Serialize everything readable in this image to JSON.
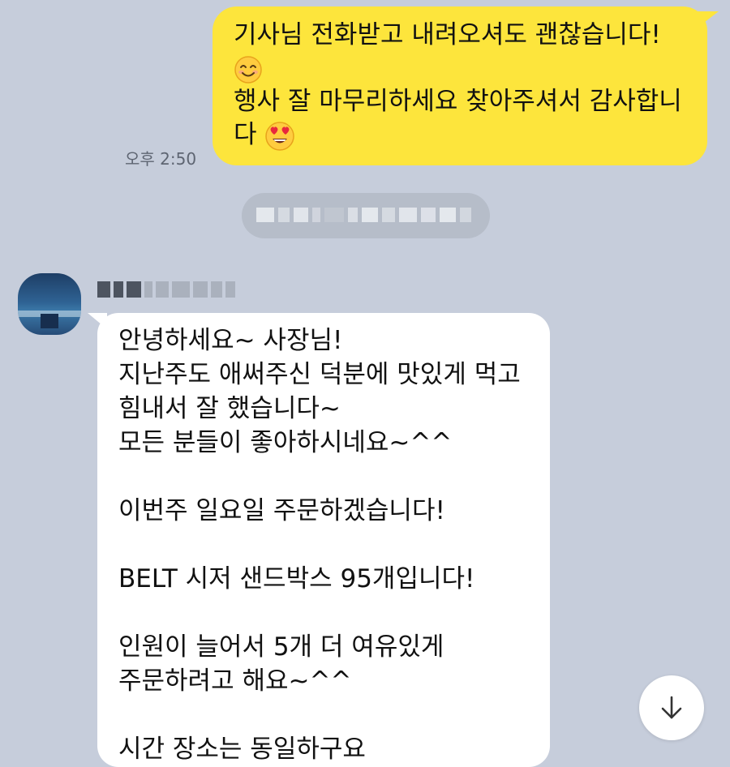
{
  "outgoing": {
    "lines": [
      "기사님 전화받고 내려오셔도 괜찮습니다!",
      "",
      "행사 잘 마무리하세요 찾아주셔서 감사합니",
      "다"
    ],
    "time": "오후 2:50",
    "emojis": [
      "smiling-face-emoji",
      "heart-eyes-emoji"
    ],
    "bubble_color": "#fde53c"
  },
  "incoming": {
    "lines": [
      "안녕하세요~ 사장님!",
      "지난주도 애써주신 덕분에 맛있게 먹고",
      "힘내서 잘 했습니다~",
      "모든 분들이 좋아하시네요~^^",
      "",
      "이번주 일요일 주문하겠습니다!",
      "",
      "BELT 시저 샌드박스 95개입니다!",
      "",
      "인원이 늘어서 5개 더 여유있게",
      "주문하려고 해요~^^",
      "",
      "시간 장소는 동일하구요"
    ],
    "bubble_color": "#ffffff"
  },
  "chat_background": "#c6cddb",
  "scroll_button_icon": "arrow-down-icon"
}
